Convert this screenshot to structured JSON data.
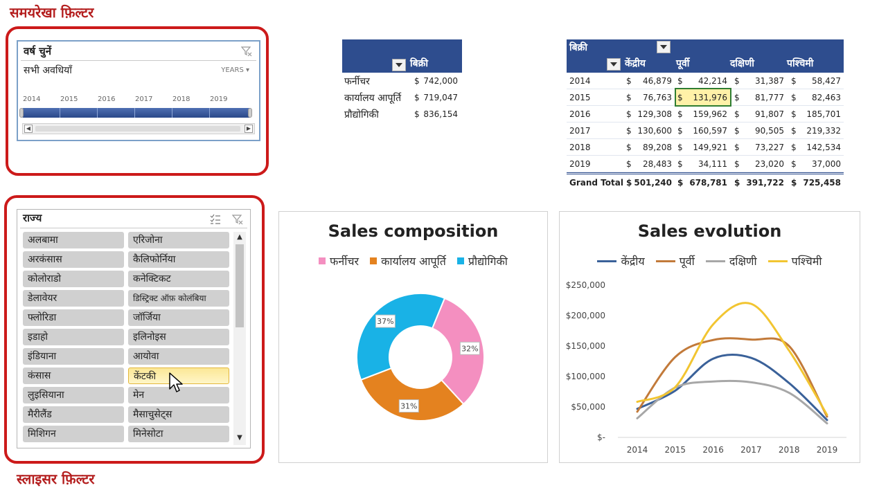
{
  "annotations": {
    "timeline_title": "समयरेखा फ़िल्टर",
    "slicer_title": "स्लाइसर फ़िल्टर"
  },
  "timeline": {
    "header": "वर्ष चुनें",
    "subtitle": "सभी अवधियाँ",
    "unit_button": "YEARS ▾",
    "years": [
      "2014",
      "2015",
      "2016",
      "2017",
      "2018",
      "2019"
    ],
    "icons": {
      "clear": "clear-filter-icon",
      "scroll_left": "chevron-left-icon",
      "scroll_right": "chevron-right-icon"
    }
  },
  "pivot1": {
    "header": "बिक्री",
    "rows": [
      {
        "label": "फर्नीचर",
        "cur": "$",
        "value": "742,000"
      },
      {
        "label": "कार्यालय आपूर्ति",
        "cur": "$",
        "value": "719,047"
      },
      {
        "label": "प्रौद्योगिकी",
        "cur": "$",
        "value": "836,154"
      }
    ]
  },
  "pivot2": {
    "header": "बिक्री",
    "columns": [
      "केंद्रीय",
      "पूर्वी",
      "दक्षिणी",
      "पश्चिमी"
    ],
    "rows": [
      {
        "year": "2014",
        "values": [
          "46,879",
          "42,214",
          "31,387",
          "58,427"
        ]
      },
      {
        "year": "2015",
        "values": [
          "76,763",
          "131,976",
          "81,777",
          "82,463"
        ]
      },
      {
        "year": "2016",
        "values": [
          "129,308",
          "159,962",
          "91,807",
          "185,701"
        ]
      },
      {
        "year": "2017",
        "values": [
          "130,600",
          "160,597",
          "90,505",
          "219,332"
        ]
      },
      {
        "year": "2018",
        "values": [
          "89,208",
          "149,921",
          "73,227",
          "142,534"
        ]
      },
      {
        "year": "2019",
        "values": [
          "28,483",
          "34,111",
          "23,020",
          "37,000"
        ]
      }
    ],
    "total": {
      "label": "Grand Total",
      "values": [
        "501,240",
        "678,781",
        "391,722",
        "725,458"
      ]
    },
    "currency": "$"
  },
  "state_slicer": {
    "header": "राज्य",
    "items": [
      "अलबामा",
      "एरिजोना",
      "अरकंसास",
      "कैलिफोर्निया",
      "कोलोराडो",
      "कनेक्टिकट",
      "डेलावेयर",
      "डिस्ट्रिक्ट ऑफ़ कोलंबिया",
      "फ्लोरिडा",
      "जॉर्जिया",
      "इडाहो",
      "इलिनोइस",
      "इंडियाना",
      "आयोवा",
      "कंसास",
      "केंटकी",
      "लुइसियाना",
      "मेन",
      "मैरीलैंड",
      "मैसाचुसेट्स",
      "मिशिगन",
      "मिनेसोटा"
    ],
    "selected": "केंटकी",
    "icons": {
      "multiselect": "multi-select-icon",
      "clear": "clear-filter-icon"
    }
  },
  "chart_data": [
    {
      "type": "pie",
      "title": "Sales composition",
      "categories": [
        "फर्नीचर",
        "कार्यालय आपूर्ति",
        "प्रौद्योगिकी"
      ],
      "values": [
        32,
        31,
        37
      ],
      "labels": [
        "32%",
        "31%",
        "37%"
      ],
      "colors": [
        "#f48fc0",
        "#e4821f",
        "#19b2e6"
      ],
      "donut": true,
      "legend": "top"
    },
    {
      "type": "line",
      "title": "Sales evolution",
      "x": [
        "2014",
        "2015",
        "2016",
        "2017",
        "2018",
        "2019"
      ],
      "series": [
        {
          "name": "केंद्रीय",
          "color": "#3a6199",
          "values": [
            46879,
            76763,
            129308,
            130600,
            89208,
            28483
          ]
        },
        {
          "name": "पूर्वी",
          "color": "#c27a3a",
          "values": [
            42214,
            131976,
            159962,
            160597,
            149921,
            34111
          ]
        },
        {
          "name": "दक्षिणी",
          "color": "#a7a7a7",
          "values": [
            31387,
            81777,
            91807,
            90505,
            73227,
            23020
          ]
        },
        {
          "name": "पश्चिमी",
          "color": "#f2c531",
          "values": [
            58427,
            82463,
            185701,
            219332,
            142534,
            37000
          ]
        }
      ],
      "yticks": [
        "$-",
        "$50,000",
        "$100,000",
        "$150,000",
        "$200,000",
        "$250,000"
      ],
      "ylim": [
        0,
        250000
      ],
      "grid": false,
      "legend": "top"
    }
  ]
}
